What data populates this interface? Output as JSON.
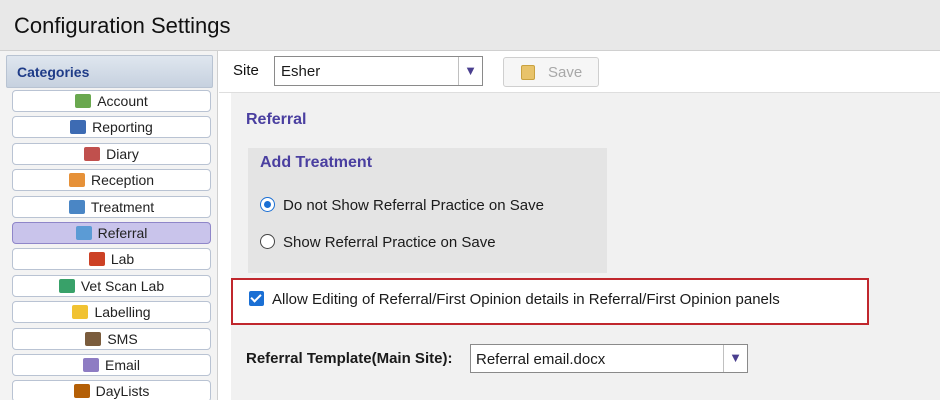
{
  "window": {
    "title": "Configuration Settings"
  },
  "sidebar": {
    "header": "Categories",
    "items": [
      {
        "label": "Account",
        "icon": "account-icon",
        "color": "#6aa84f"
      },
      {
        "label": "Reporting",
        "icon": "reporting-icon",
        "color": "#3d6bb3"
      },
      {
        "label": "Diary",
        "icon": "diary-icon",
        "color": "#c0504d"
      },
      {
        "label": "Reception",
        "icon": "reception-icon",
        "color": "#e69138"
      },
      {
        "label": "Treatment",
        "icon": "treatment-icon",
        "color": "#4a86c5"
      },
      {
        "label": "Referral",
        "icon": "referral-icon",
        "color": "#5b9bd5",
        "selected": true
      },
      {
        "label": "Lab",
        "icon": "lab-icon",
        "color": "#cc4125"
      },
      {
        "label": "Vet Scan Lab",
        "icon": "vet-scan-lab-icon",
        "color": "#38a169"
      },
      {
        "label": "Labelling",
        "icon": "labelling-icon",
        "color": "#f1c232"
      },
      {
        "label": "SMS",
        "icon": "sms-icon",
        "color": "#7a5c3c"
      },
      {
        "label": "Email",
        "icon": "email-icon",
        "color": "#8e7cc3"
      },
      {
        "label": "DayLists",
        "icon": "daylists-icon",
        "color": "#b45f06"
      }
    ]
  },
  "toolbar": {
    "site_label": "Site",
    "site_value": "Esher",
    "save_label": "Save"
  },
  "referral": {
    "section_title": "Referral",
    "add_treatment": {
      "title": "Add Treatment",
      "options": [
        {
          "label": "Do not Show Referral Practice on Save",
          "selected": true
        },
        {
          "label": "Show Referral Practice on Save",
          "selected": false
        }
      ]
    },
    "allow_editing_label": "Allow Editing of Referral/First Opinion details in Referral/First Opinion panels",
    "allow_editing_checked": true,
    "template_label": "Referral Template(Main Site):",
    "template_value": "Referral email.docx"
  },
  "colors": {
    "accent": "#4a3fa0",
    "highlight_border": "#c0272d",
    "control_blue": "#1a6fd4",
    "selected_category": "#c9c4eb"
  }
}
